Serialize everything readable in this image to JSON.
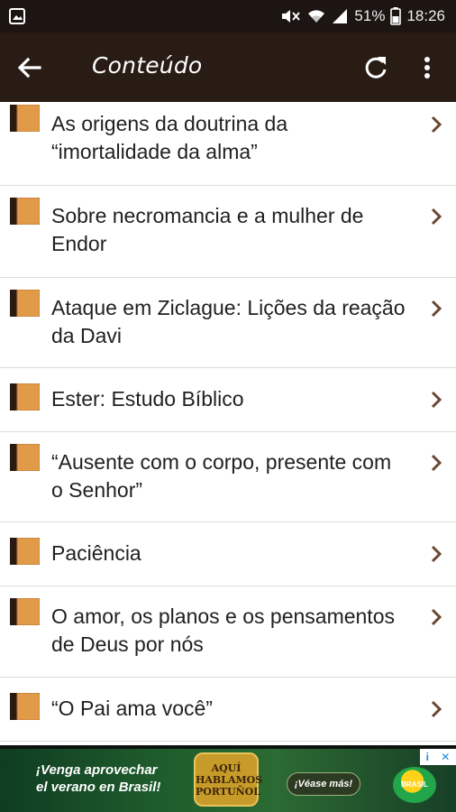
{
  "status_bar": {
    "battery": "51%",
    "time": "18:26",
    "icons": [
      "gallery-icon",
      "mute-icon",
      "wifi-icon",
      "signal-icon",
      "battery-icon"
    ]
  },
  "app_bar": {
    "title": "Conteúdo",
    "icons": [
      "arrow-back-icon",
      "refresh-icon",
      "more-vert-icon"
    ]
  },
  "list": {
    "items": [
      {
        "title": "As origens da doutrina da “imortalidade da alma”"
      },
      {
        "title": "Sobre necromancia e a mulher de Endor"
      },
      {
        "title": "Ataque em Ziclague: Lições da reação da Davi"
      },
      {
        "title": "Ester: Estudo Bíblico"
      },
      {
        "title": "“Ausente com o corpo, presente com o Senhor”"
      },
      {
        "title": "Paciência"
      },
      {
        "title": "O amor, os planos e os pensamentos de Deus por nós"
      },
      {
        "title": "“O Pai ama você”"
      }
    ]
  },
  "ad": {
    "slogan": "¡Venga aprovechar el verano en Brasil!",
    "logo_text": "AQUÍ HABLAMOS PORTUÑOL",
    "cta": "¡Véase más!",
    "brand": "BRASIL",
    "choices": [
      "i",
      "✕"
    ]
  },
  "colors": {
    "status_bar": "#1c1512",
    "app_bar": "#281c15",
    "book": "#e09a48",
    "chevron": "#6b4733",
    "divider": "#dcdcdc"
  }
}
